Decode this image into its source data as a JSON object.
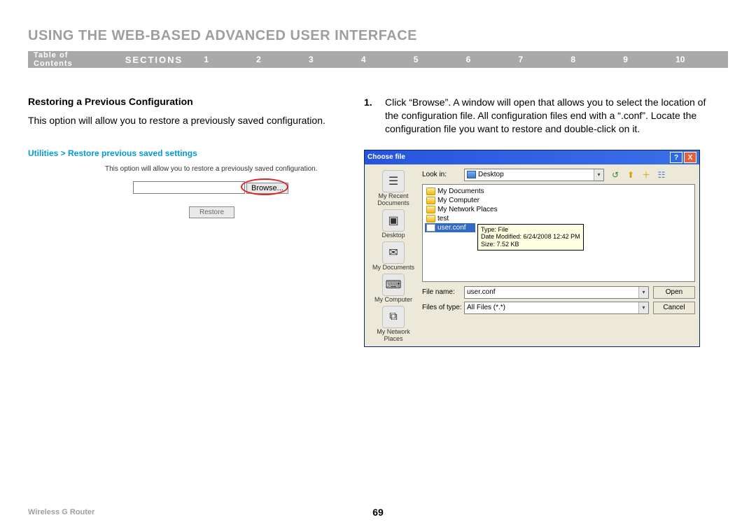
{
  "header": {
    "chapter_title": "USING THE WEB-BASED ADVANCED USER INTERFACE",
    "toc": "Table of Contents",
    "sections": "SECTIONS",
    "nums": [
      "1",
      "2",
      "3",
      "4",
      "5",
      "6",
      "7",
      "8",
      "9",
      "10"
    ],
    "active_index": 5
  },
  "left": {
    "sub_heading": "Restoring a Previous Configuration",
    "body_text": "This option will allow you to restore a previously saved configuration.",
    "breadcrumb": "Utilities > Restore previous saved settings",
    "desc_small": "This option will allow you to restore a previously saved configuration.",
    "browse_label": "Browse...",
    "restore_label": "Restore"
  },
  "right": {
    "step_num": "1.",
    "step_text": "Click “Browse”. A window will open that allows you to select the location of the configuration file. All configuration files end with a “.conf”. Locate the configuration file you want to restore and double-click on it."
  },
  "dialog": {
    "title": "Choose file",
    "lookin_label": "Look in:",
    "lookin_value": "Desktop",
    "sidebar": [
      {
        "icon": "☰",
        "label": "My Recent Documents"
      },
      {
        "icon": "▣",
        "label": "Desktop"
      },
      {
        "icon": "✉",
        "label": "My Documents"
      },
      {
        "icon": "⌨",
        "label": "My Computer"
      },
      {
        "icon": "⧉",
        "label": "My Network Places"
      }
    ],
    "files": [
      {
        "name": "My Documents",
        "type": "folder"
      },
      {
        "name": "My Computer",
        "type": "folder"
      },
      {
        "name": "My Network Places",
        "type": "folder"
      },
      {
        "name": "test",
        "type": "folder"
      },
      {
        "name": "user.conf",
        "type": "file",
        "selected": true
      }
    ],
    "tooltip": {
      "line1": "Type: File",
      "line2": "Date Modified: 6/24/2008 12:42 PM",
      "line3": "Size: 7.52 KB"
    },
    "filename_label": "File name:",
    "filename_value": "user.conf",
    "filetype_label": "Files of type:",
    "filetype_value": "All Files (*.*)",
    "open_label": "Open",
    "cancel_label": "Cancel",
    "toolbar_icons": [
      "↺",
      "⬆",
      "＋",
      "☷"
    ]
  },
  "footer": {
    "product": "Wireless G Router",
    "page": "69"
  }
}
